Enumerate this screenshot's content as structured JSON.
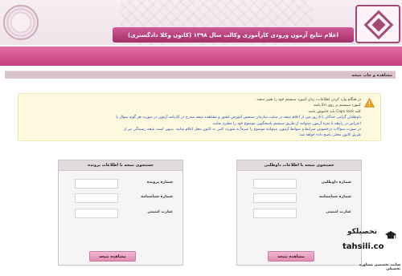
{
  "header": {
    "title": "اعلام نتایج آزمون ورودی کارآموزی وکالت سال ۱۳۹۸ (کانون وکلا دادگستری)"
  },
  "section": {
    "title": "مشاهده و چاپ نتیجه"
  },
  "notice": {
    "lines": [
      "در هنگام وارد کردن اطلاعات، زبان کیبورد سیستم خود را تغییر ندهید.",
      "کیبورد سیستم بر روی En باشد",
      "کلید Caps lock باید خاموش باشد.",
      "داوطلبان گرامی حداکثر تا ۵ روز پس از اعلام نتیجه در سایت سازمان سنجش آموزش کشور و مشاهده نتیجه مندرج در کارنامه آزمون در صورت هر گونه سوال یا",
      "اعتراض در رابطه با نمره آزمون میتوانند از طریق سیستم پاسخگویی موضوع خود را مطرح نمایند.",
      "در صورت سوالات درخصوص شرایط و ضوابط آزمون، میتوانند موضوع را صرفاً به صورت کتبی به کانون محل اعلام نمایند. بدیهی است نتیجه رسیدگی نیز از",
      "طریق کانون محلی پاسخ داده خواهد شد."
    ]
  },
  "panel_left": {
    "title": "جستجوی نتیجه با اطلاعات پرونده",
    "fields": [
      {
        "label": "شماره پرونده",
        "value": ""
      },
      {
        "label": "شماره شناسنامه",
        "value": ""
      },
      {
        "label": "عبارت امنیتی",
        "value": ""
      }
    ],
    "button": "مشاهده نتیجه"
  },
  "panel_right": {
    "title": "جستجوی نتیجه با اطلاعات داوطلبی",
    "fields": [
      {
        "label": "شماره داوطلبی",
        "value": ""
      },
      {
        "label": "شماره شناسنامه",
        "value": ""
      },
      {
        "label": "عبارت امنیتی",
        "value": ""
      }
    ],
    "button": "مشاهده نتیجه"
  },
  "watermark": {
    "brand": "تحصیلکو",
    "url": "tahsili.co",
    "subtitle": "سایت تخصصی مشاوره تحصیلی"
  },
  "colors": {
    "accent": "#c63f7f",
    "title_bar": "#a3306b",
    "notice_bg": "#fdf9df",
    "warning": "#e8a21b"
  }
}
